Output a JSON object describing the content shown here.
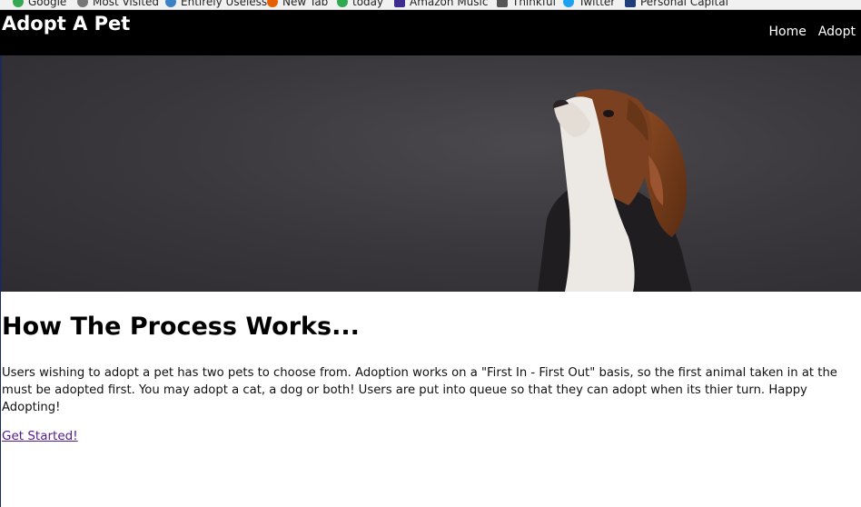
{
  "bookmarks": [
    {
      "label": "Google",
      "icon": "google-icon",
      "color": "#34a853"
    },
    {
      "label": "Most Visited",
      "icon": "gear-icon",
      "color": "#777777"
    },
    {
      "label": "Entirely Useless",
      "icon": "globe-icon",
      "color": "#3b82c4"
    },
    {
      "label": "New Tab",
      "icon": "firefox-icon",
      "color": "#e66000"
    },
    {
      "label": "today",
      "icon": "check-icon",
      "color": "#2fa84f"
    },
    {
      "label": "Amazon Music",
      "icon": "grid-icon",
      "color": "#3d2b8f"
    },
    {
      "label": "Thinkful",
      "icon": "page-icon",
      "color": "#555555"
    },
    {
      "label": "Twitter",
      "icon": "twitter-icon",
      "color": "#1da1f2"
    },
    {
      "label": "Personal Capital",
      "icon": "pc-icon",
      "color": "#1f3d7a"
    }
  ],
  "navbar": {
    "brand": "Adopt A Pet",
    "links": [
      "Home",
      "Adopt"
    ]
  },
  "hero": {
    "image": "dog-photo"
  },
  "main": {
    "heading": "How The Process Works...",
    "description": "Users wishing to adopt a pet has two pets to choose from. Adoption works on a \"First In - First Out\" basis, so the first animal taken in at the must be adopted first. You may adopt a cat, a dog or both! Users are put into queue so that they can adopt when its thier turn. Happy Adopting!",
    "cta_label": "Get Started!"
  },
  "colors": {
    "navbar_bg": "#000000",
    "link_visited": "#551a8b"
  }
}
